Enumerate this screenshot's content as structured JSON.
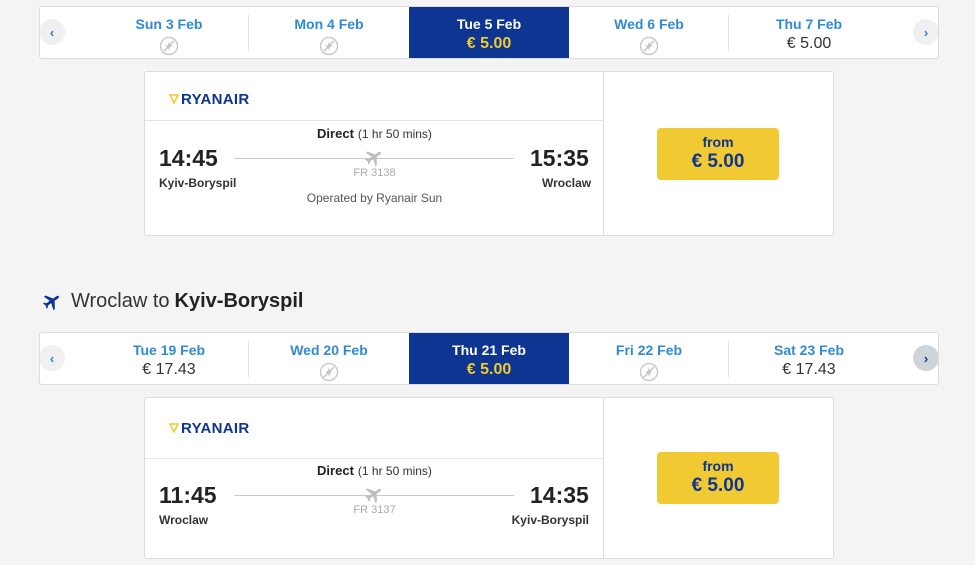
{
  "colors": {
    "brand": "#0d3591",
    "accent": "#f1c933",
    "link": "#2f8ad6"
  },
  "outbound": {
    "dates": [
      {
        "label": "Sun 3 Feb",
        "price": null,
        "selected": false
      },
      {
        "label": "Mon 4 Feb",
        "price": null,
        "selected": false
      },
      {
        "label": "Tue 5 Feb",
        "price": "€ 5.00",
        "selected": true
      },
      {
        "label": "Wed 6 Feb",
        "price": null,
        "selected": false
      },
      {
        "label": "Thu 7 Feb",
        "price": "€ 5.00",
        "selected": false
      }
    ],
    "flight": {
      "airline": "RYANAIR",
      "depart_time": "14:45",
      "depart_city": "Kyiv-Boryspil",
      "arrive_time": "15:35",
      "arrive_city": "Wroclaw",
      "direct_label": "Direct",
      "duration": "(1 hr 50 mins)",
      "flight_no": "FR 3138",
      "operated_by": "Operated by Ryanair Sun",
      "price_from": "from",
      "price": "€ 5.00"
    }
  },
  "return_section": {
    "title_from": "Wroclaw to",
    "title_to": "Kyiv-Boryspil",
    "icon": "plane-icon"
  },
  "inbound": {
    "dates": [
      {
        "label": "Tue 19 Feb",
        "price": "€ 17.43",
        "selected": false
      },
      {
        "label": "Wed 20 Feb",
        "price": null,
        "selected": false
      },
      {
        "label": "Thu 21 Feb",
        "price": "€ 5.00",
        "selected": true
      },
      {
        "label": "Fri 22 Feb",
        "price": null,
        "selected": false
      },
      {
        "label": "Sat 23 Feb",
        "price": "€ 17.43",
        "selected": false
      }
    ],
    "flight": {
      "airline": "RYANAIR",
      "depart_time": "11:45",
      "depart_city": "Wroclaw",
      "arrive_time": "14:35",
      "arrive_city": "Kyiv-Boryspil",
      "direct_label": "Direct",
      "duration": "(1 hr 50 mins)",
      "flight_no": "FR 3137",
      "price_from": "from",
      "price": "€ 5.00"
    }
  },
  "nav": {
    "prev_icon": "chevron-left-icon",
    "next_icon": "chevron-right-icon"
  }
}
